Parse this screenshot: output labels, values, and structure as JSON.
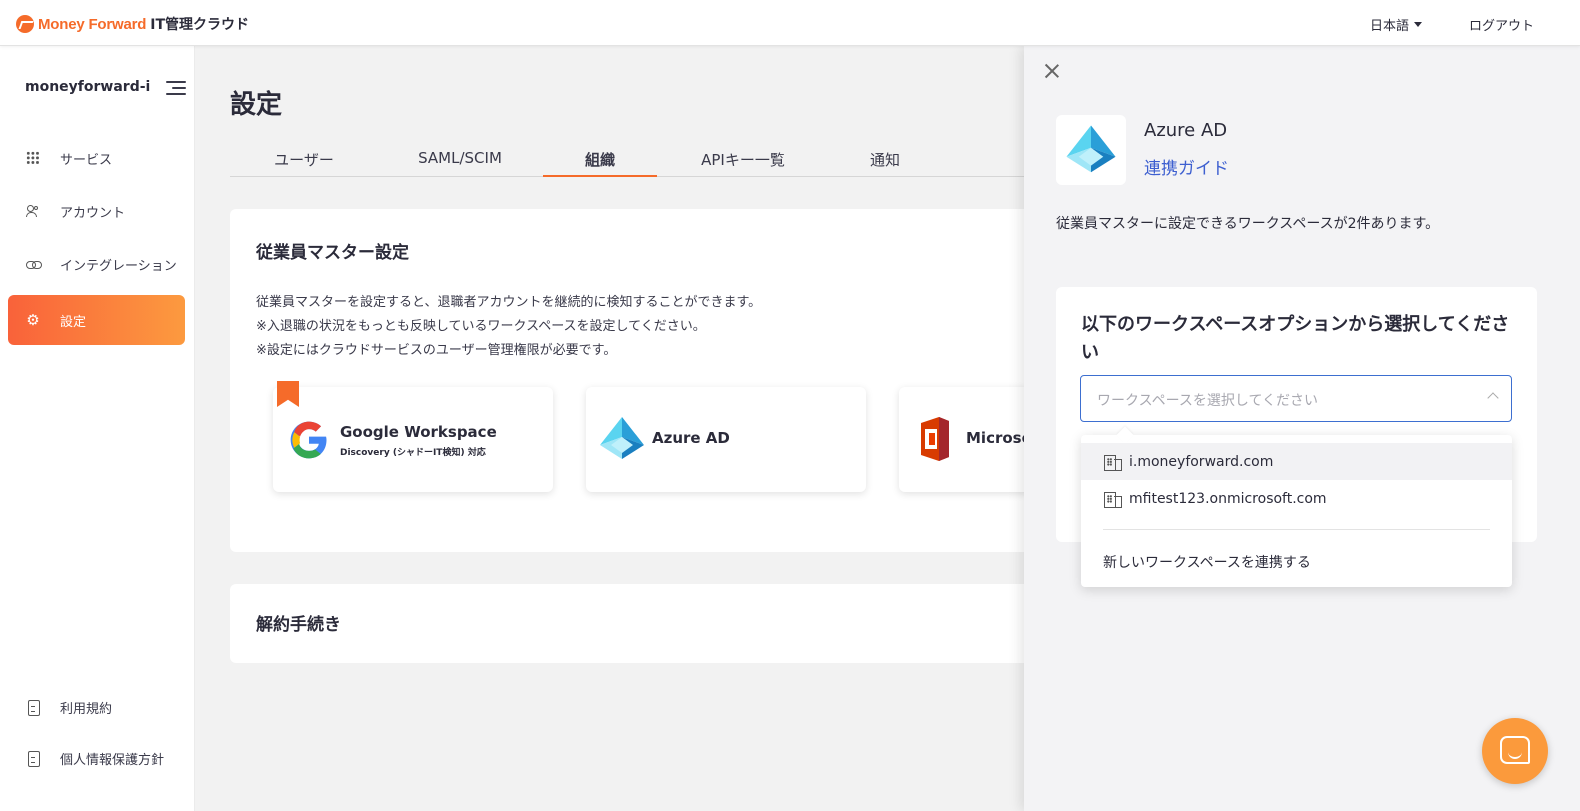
{
  "header": {
    "logo_brand": "Money Forward",
    "logo_product": "IT管理クラウド",
    "language": "日本語",
    "logout": "ログアウト"
  },
  "sidebar": {
    "org_name": "moneyforward-i",
    "items": [
      {
        "label": "サービス",
        "icon": "grid-icon"
      },
      {
        "label": "アカウント",
        "icon": "people-icon"
      },
      {
        "label": "インテグレーション",
        "icon": "link-icon"
      },
      {
        "label": "設定",
        "icon": "gear-icon",
        "active": true
      }
    ],
    "footer_items": [
      {
        "label": "利用規約",
        "icon": "document-icon"
      },
      {
        "label": "個人情報保護方針",
        "icon": "document-icon"
      }
    ]
  },
  "main": {
    "title": "設定",
    "tabs": [
      {
        "label": "ユーザー"
      },
      {
        "label": "SAML/SCIM"
      },
      {
        "label": "組織",
        "active": true
      },
      {
        "label": "APIキー一覧"
      },
      {
        "label": "通知"
      }
    ],
    "employee_master": {
      "title": "従業員マスター設定",
      "description": [
        "従業員マスターを設定すると、退職者アカウントを継続的に検知することができます。",
        "※入退職の状況をもっとも反映しているワークスペースを設定してください。",
        "※設定にはクラウドサービスのユーザー管理権限が必要です。"
      ],
      "services": [
        {
          "name": "Google Workspace",
          "sub": "Discovery (シャドーIT検知) 対応"
        },
        {
          "name": "Azure AD"
        },
        {
          "name": "Microso"
        }
      ]
    },
    "cancellation": {
      "title": "解約手続き"
    }
  },
  "panel": {
    "service_name": "Azure AD",
    "guide_link": "連携ガイド",
    "info_text": "従業員マスターに設定できるワークスペースが2件あります。",
    "select_title": "以下のワークスペースオプションから選択してください",
    "select_placeholder": "ワークスペースを選択してください",
    "options": [
      {
        "label": "i.moneyforward.com"
      },
      {
        "label": "mfitest123.onmicrosoft.com"
      }
    ],
    "new_workspace": "新しいワークスペースを連携する"
  },
  "colors": {
    "accent": "#f56b2a",
    "link": "#3d5fd0",
    "select_border": "#3d6fd0"
  }
}
